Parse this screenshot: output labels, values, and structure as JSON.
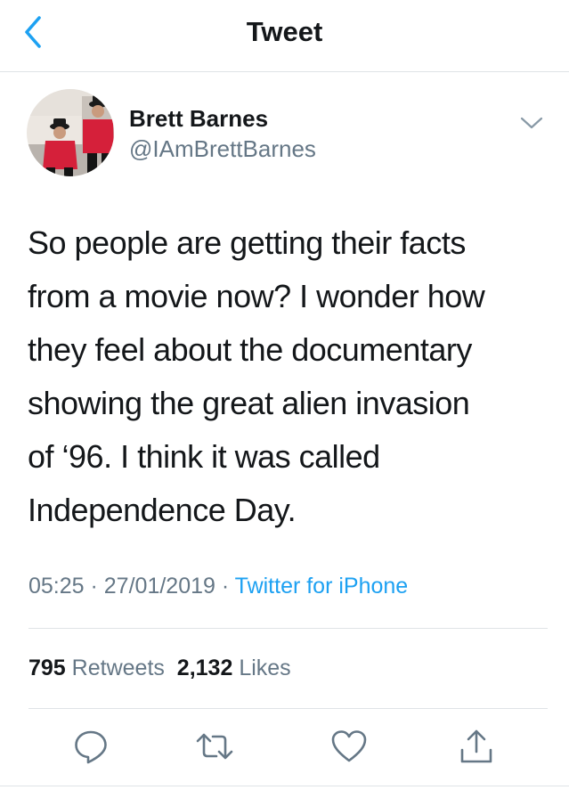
{
  "nav": {
    "title": "Tweet",
    "back_icon": "chevron-left-icon"
  },
  "author": {
    "name": "Brett Barnes",
    "handle": "@IAmBrettBarnes",
    "menu_icon": "chevron-down-icon"
  },
  "tweet": {
    "lines": [
      "So people are getting their facts",
      "from a movie now? I wonder how",
      "they feel about the documentary",
      "showing the great alien invasion",
      "of ‘96. I think it was called",
      "Independence Day."
    ]
  },
  "meta": {
    "time": "05:25",
    "sep1": " · ",
    "date": "27/01/2019",
    "sep2": " · ",
    "source": "Twitter for iPhone"
  },
  "stats": {
    "retweets_count": "795",
    "retweets_label": "Retweets",
    "likes_count": "2,132",
    "likes_label": "Likes"
  },
  "actions": [
    "reply-icon",
    "retweet-icon",
    "like-icon",
    "share-icon"
  ],
  "colors": {
    "accent": "#1da1f2",
    "text": "#14171a",
    "secondary": "#657786",
    "divider": "#dfe3e6"
  }
}
